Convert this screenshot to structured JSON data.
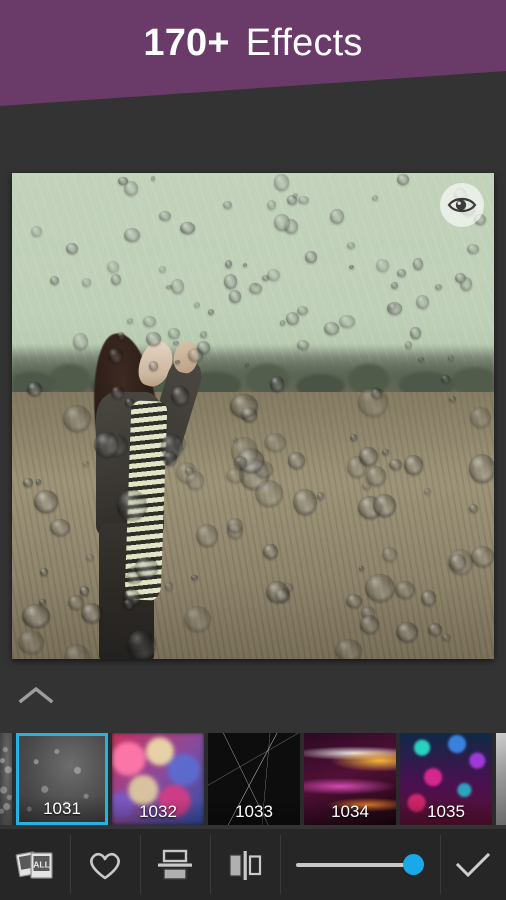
{
  "banner": {
    "count": "170+",
    "word": "Effects",
    "color": "#6a3a69"
  },
  "preview": {
    "eye_icon": "eye-icon",
    "image_description": "Woman with raised arm in a rainy field with water droplet overlay",
    "collapse_icon": "chevron-up-icon"
  },
  "thumbnails": {
    "selected_index": 0,
    "selection_color": "#22b4e6",
    "items": [
      {
        "label": "",
        "art": "t-rain",
        "partial": "left"
      },
      {
        "label": "1031",
        "art": "t-rain",
        "selected": true
      },
      {
        "label": "1032",
        "art": "t-bokeh"
      },
      {
        "label": "1033",
        "art": "t-crack"
      },
      {
        "label": "1034",
        "art": "t-lightstreak"
      },
      {
        "label": "1035",
        "art": "t-confetti"
      },
      {
        "label": "",
        "art": "t-gray",
        "partial": "right"
      }
    ]
  },
  "toolbar": {
    "all_label": "ALL",
    "all_icon": "all-effects-icon",
    "favorite_icon": "heart-icon",
    "hsplit_icon": "horizontal-split-compare-icon",
    "vsplit_icon": "vertical-split-compare-icon",
    "slider": {
      "name": "opacity-slider",
      "value": 100,
      "min": 0,
      "max": 100,
      "thumb_color": "#17a9e8"
    },
    "confirm_icon": "checkmark-icon"
  }
}
